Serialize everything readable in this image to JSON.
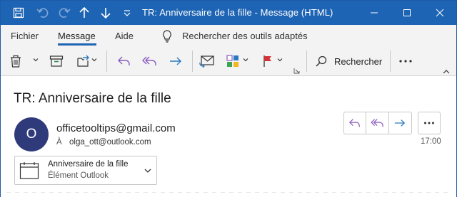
{
  "titlebar": {
    "title": "TR: Anniversaire de la fille  -  Message (HTML)",
    "icons": [
      "save-icon",
      "undo-icon",
      "redo-icon",
      "up-arrow-icon",
      "down-arrow-icon",
      "customize-quick-access-icon"
    ],
    "controls": [
      "minimize-icon",
      "maximize-icon",
      "close-icon"
    ],
    "background": "#1e64b4"
  },
  "menu": {
    "tabs": [
      {
        "label": "Fichier"
      },
      {
        "label": "Message",
        "active": true
      },
      {
        "label": "Aide"
      }
    ],
    "tell_me": "Rechercher des outils adaptés"
  },
  "ribbon": {
    "search_label": "Rechercher",
    "buttons": [
      "delete-icon",
      "archive-icon",
      "move-icon",
      "reply-icon",
      "reply-all-icon",
      "forward-icon",
      "mark-unread-icon",
      "categorize-icon",
      "flag-icon",
      "search-icon",
      "more-icon"
    ]
  },
  "message": {
    "subject": "TR: Anniversaire de la fille",
    "avatar_initial": "O",
    "avatar_color": "#2f3a7a",
    "sender": "officetooltips@gmail.com",
    "to_label": "À",
    "to": "olga_ott@outlook.com",
    "time": "17:00",
    "attachment": {
      "name": "Anniversaire de la fille",
      "type": "Élément Outlook"
    }
  },
  "colors": {
    "accent": "#1e64b4",
    "reply_purple": "#8a5bbf",
    "forward_blue": "#2b79c2",
    "flag_red": "#d13438"
  }
}
